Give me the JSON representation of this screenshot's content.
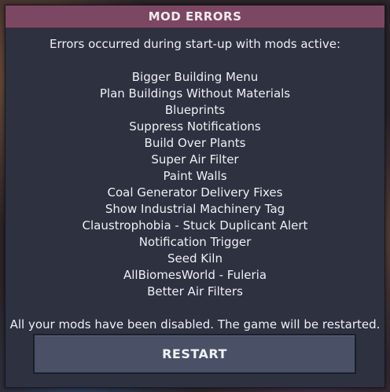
{
  "dialog": {
    "title": "MOD ERRORS",
    "header": "Errors occurred during start-up with mods active:",
    "mods": [
      "Bigger Building Menu",
      "Plan Buildings Without Materials",
      "Blueprints",
      "Suppress Notifications",
      "Build Over Plants",
      "Super Air Filter",
      "Paint Walls",
      "Coal Generator Delivery Fixes",
      "Show Industrial Machinery Tag",
      "Claustrophobia - Stuck Duplicant Alert",
      "Notification Trigger",
      "Seed Kiln",
      "AllBiomesWorld - Fuleria",
      "Better Air Filters"
    ],
    "footer": "All your mods have been disabled. The game will be restarted.",
    "restart_label": "RESTART"
  },
  "colors": {
    "title_bar": "#7c4763",
    "panel": "#2d3140",
    "button": "#4a5066",
    "text": "#eef0f4"
  }
}
